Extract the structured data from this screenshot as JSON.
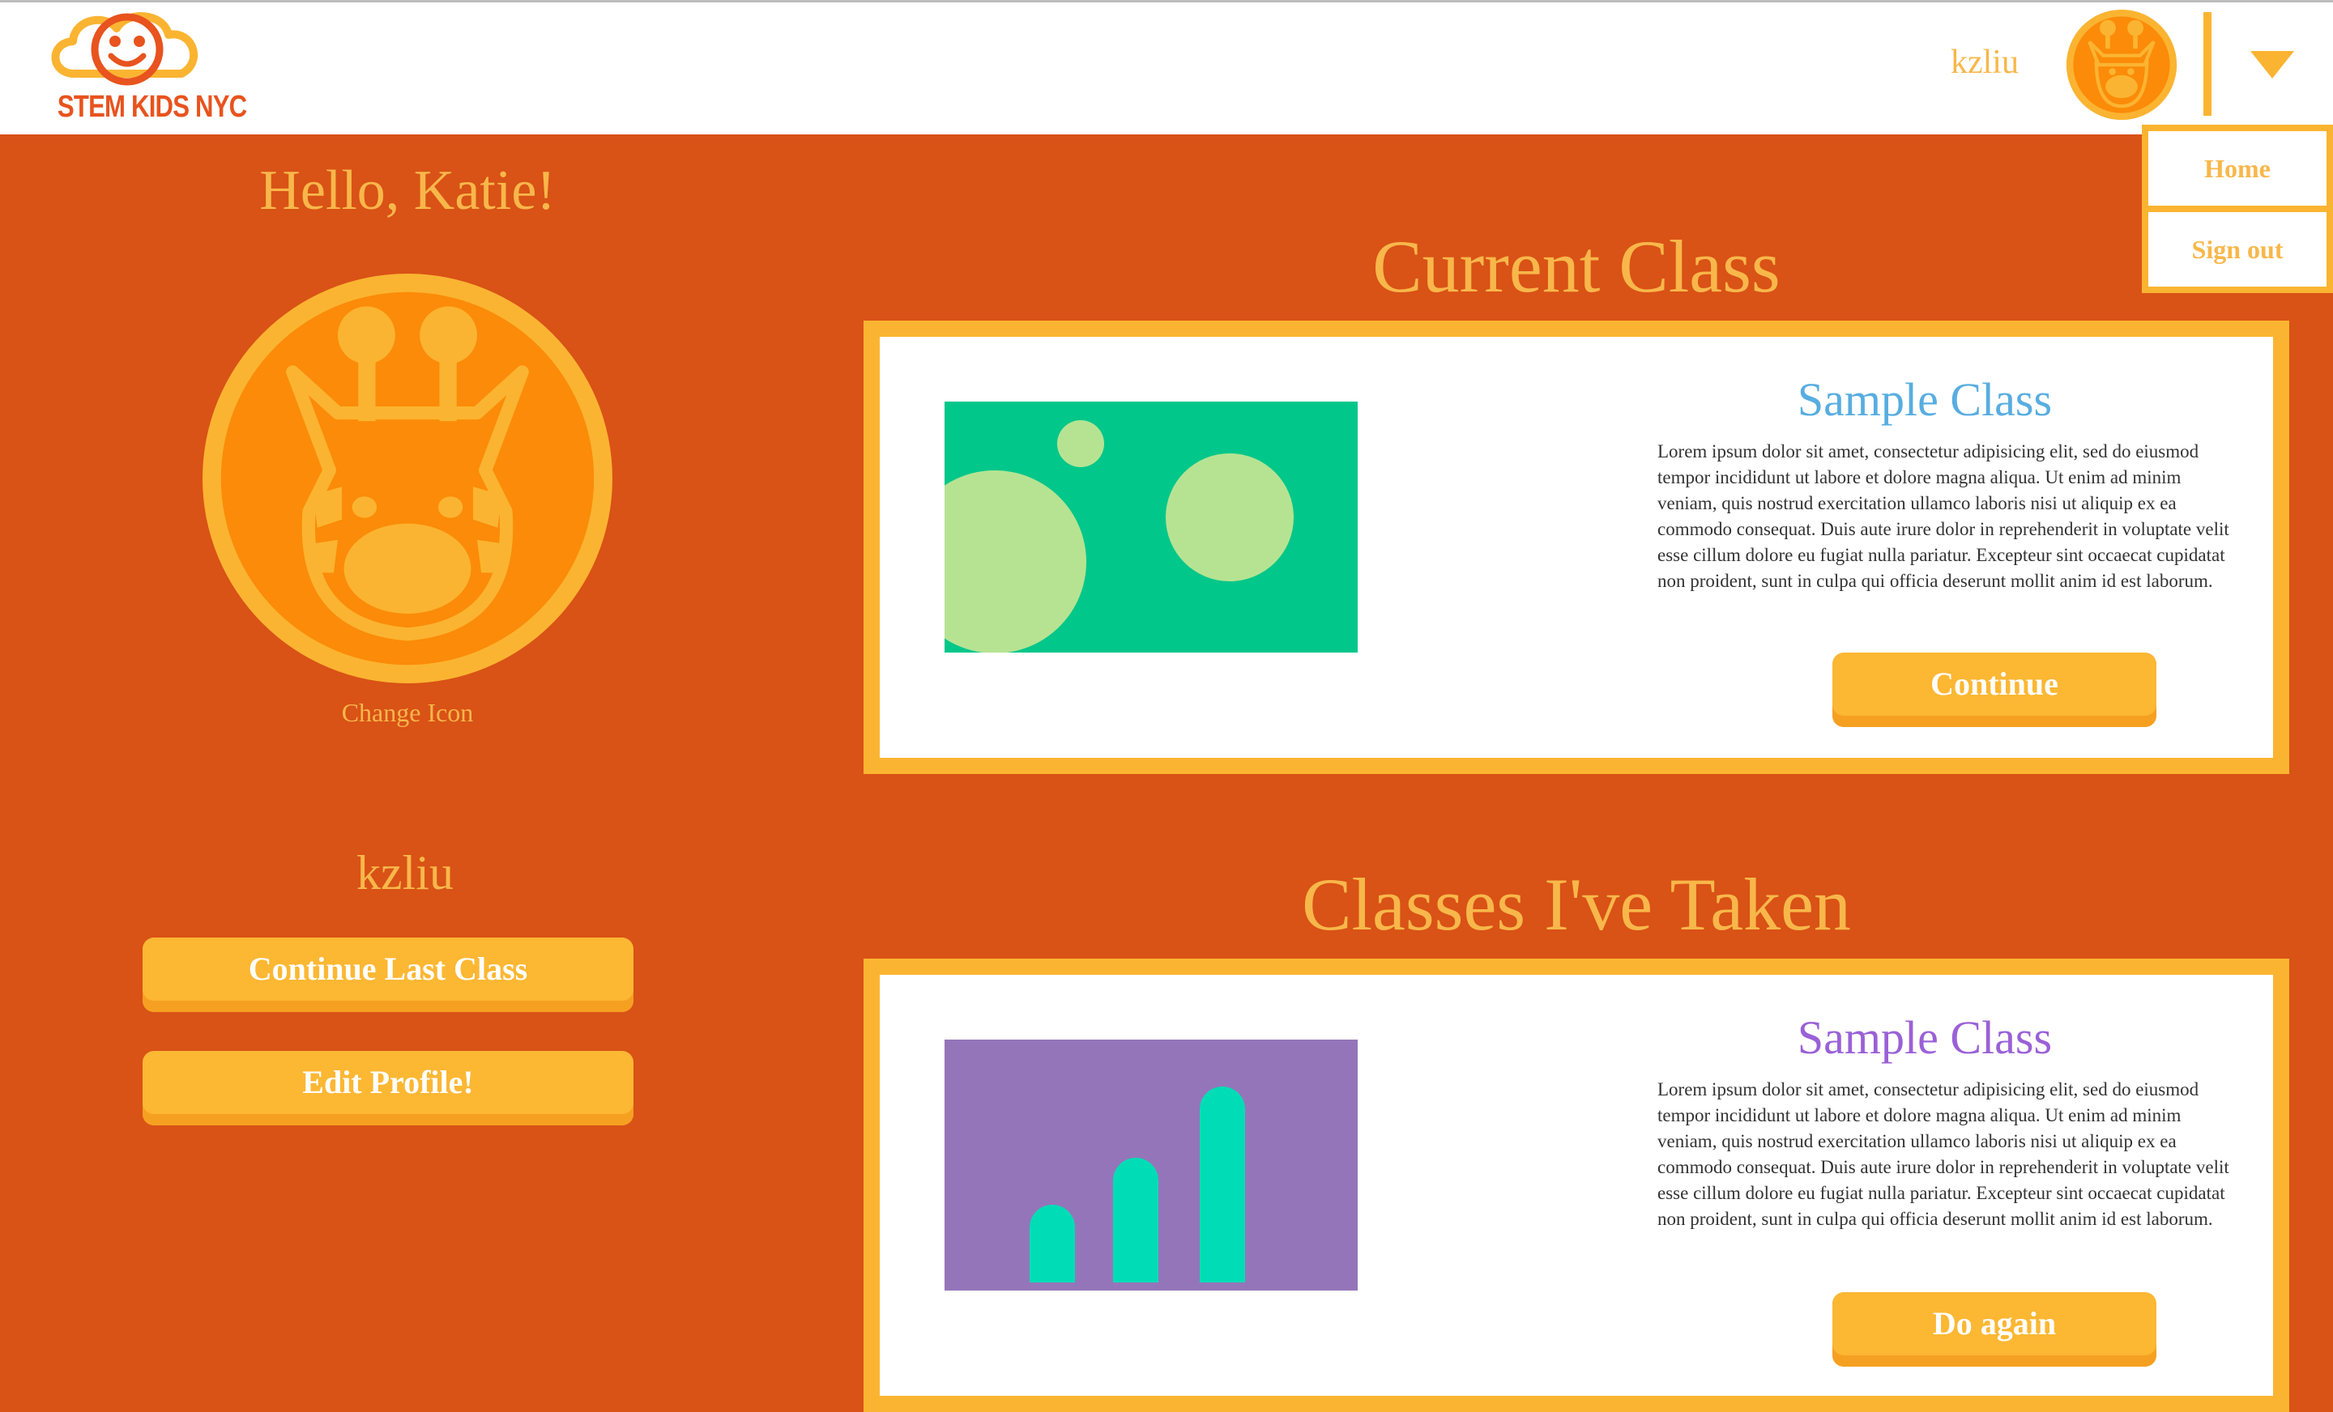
{
  "header": {
    "logo_text": "STEM KIDS NYC",
    "username": "kzliu",
    "avatar_icon": "giraffe-icon",
    "dropdown_icon": "caret-down-icon"
  },
  "dropdown": {
    "items": [
      {
        "label": "Home"
      },
      {
        "label": "Sign out"
      }
    ]
  },
  "profile": {
    "greeting": "Hello, Katie!",
    "avatar_icon": "giraffe-icon",
    "change_icon_label": "Change Icon",
    "username": "kzliu",
    "continue_last_label": "Continue Last Class",
    "edit_profile_label": "Edit Profile!"
  },
  "current_class": {
    "section_title": "Current Class",
    "title": "Sample Class",
    "description": "Lorem ipsum dolor sit amet, consectetur adipisicing elit, sed do eiusmod tempor incididunt ut labore et dolore magna aliqua. Ut enim ad minim veniam, quis nostrud exercitation ullamco laboris nisi ut aliquip ex ea commodo consequat. Duis aute irure dolor in reprehenderit in voluptate velit esse cillum dolore eu fugiat nulla pariatur. Excepteur sint occaecat cupidatat non proident, sunt in culpa qui officia deserunt mollit anim id est laborum.",
    "button_label": "Continue",
    "thumbnail_icon": "bubbles-icon"
  },
  "classes_taken": {
    "section_title": "Classes I've Taken",
    "items": [
      {
        "title": "Sample Class",
        "description": "Lorem ipsum dolor sit amet, consectetur adipisicing elit, sed do eiusmod tempor incididunt ut labore et dolore magna aliqua. Ut enim ad minim veniam, quis nostrud exercitation ullamco laboris nisi ut aliquip ex ea commodo consequat. Duis aute irure dolor in reprehenderit in voluptate velit esse cillum dolore eu fugiat nulla pariatur. Excepteur sint occaecat cupidatat non proident, sunt in culpa qui officia deserunt mollit anim id est laborum.",
        "button_label": "Do again",
        "thumbnail_icon": "bar-chart-icon"
      }
    ]
  },
  "colors": {
    "background": "#d95216",
    "accent": "#fbb431",
    "text_accent": "#f8b74a",
    "title_blue": "#58ade0",
    "title_purple": "#9a61d7",
    "thumb_green": "#02c78a",
    "thumb_purple": "#9575b9"
  }
}
